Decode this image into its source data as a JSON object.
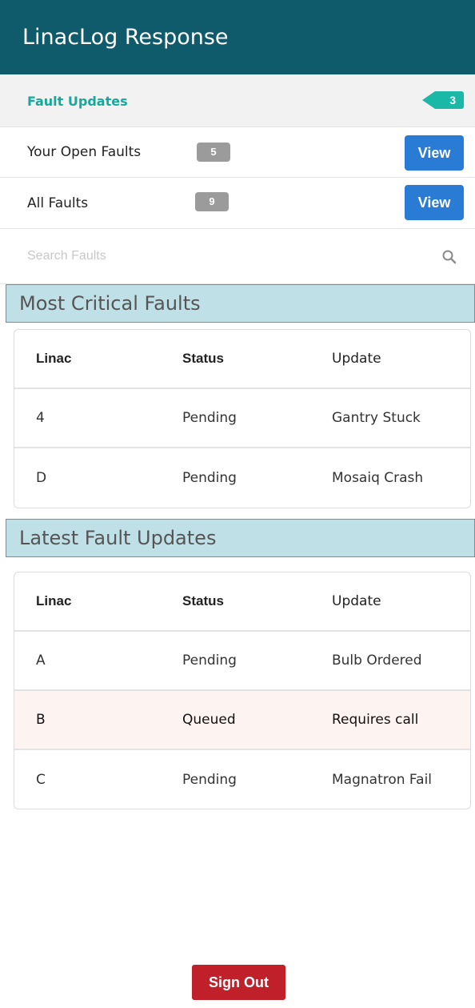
{
  "app": {
    "title": "LinacLog Response"
  },
  "menu": {
    "fault_updates": {
      "label": "Fault Updates",
      "count": "3"
    },
    "open_faults": {
      "label": "Your Open Faults",
      "count": "5",
      "button": "View"
    },
    "all_faults": {
      "label": "All Faults",
      "count": "9",
      "button": "View"
    },
    "search": {
      "placeholder": "Search Faults",
      "value": ""
    }
  },
  "critical": {
    "title": "Most Critical Faults",
    "headers": [
      "Linac",
      "Status",
      "Update"
    ],
    "rows": [
      {
        "linac": "4",
        "status": "Pending",
        "update": "Gantry Stuck"
      },
      {
        "linac": "D",
        "status": "Pending",
        "update": "Mosaiq Crash"
      }
    ]
  },
  "latest": {
    "title": "Latest Fault Updates",
    "headers": [
      "Linac",
      "Status",
      "Update"
    ],
    "rows": [
      {
        "linac": "A",
        "status": "Pending",
        "update": "Bulb Ordered"
      },
      {
        "linac": "B",
        "status": "Queued",
        "update": "Requires call"
      },
      {
        "linac": "C",
        "status": "Pending",
        "update": "Magnatron Fail"
      }
    ]
  },
  "footer": {
    "signout_label": "Sign Out"
  },
  "colors": {
    "header_bg": "#0f5a6b",
    "accent_teal": "#17a89c",
    "view_button": "#2a7bd3",
    "section_bar": "#bfe0e6",
    "signout": "#c0202a",
    "highlight_row": "#fdf3f1"
  }
}
